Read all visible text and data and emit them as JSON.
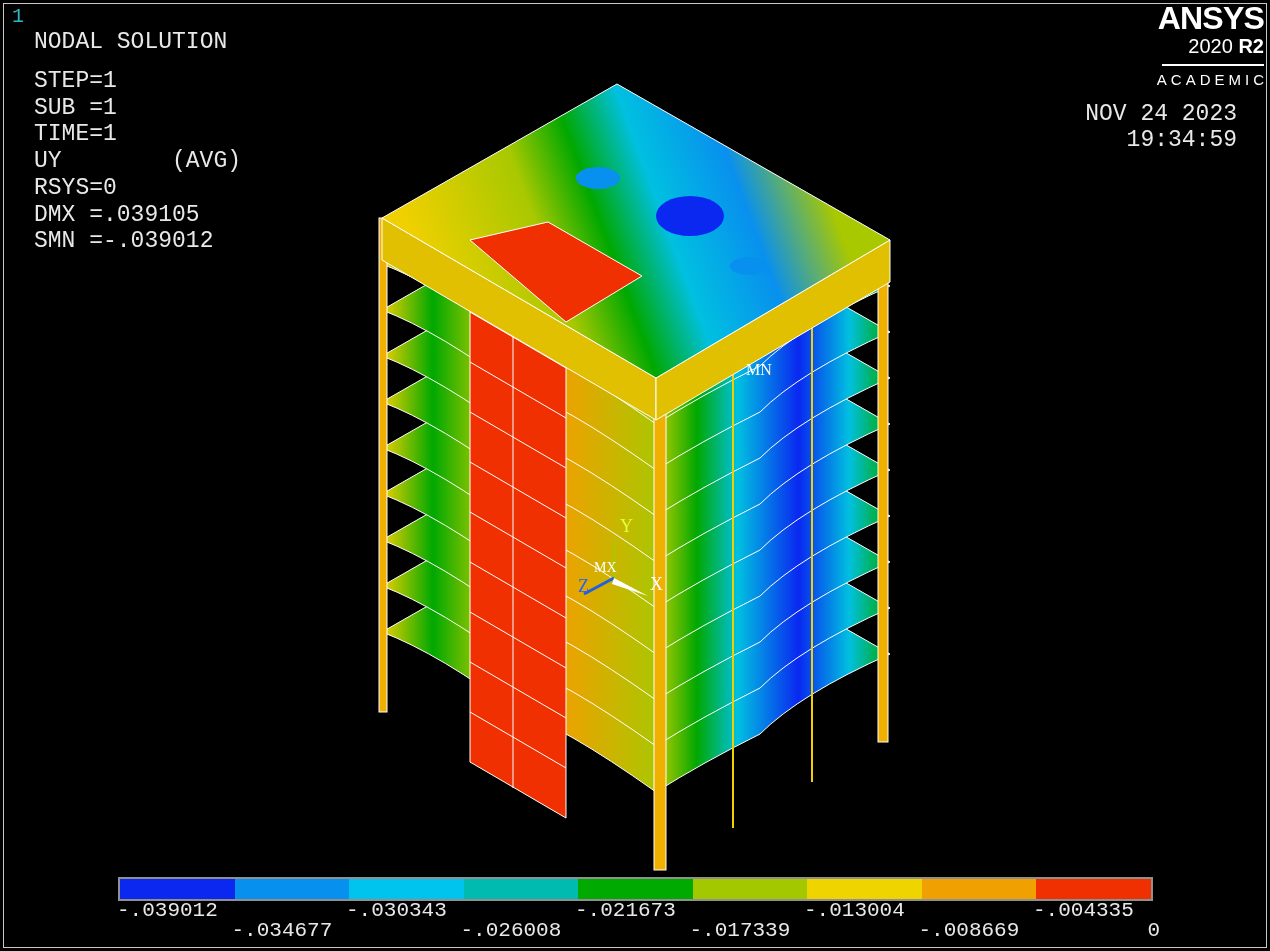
{
  "window_number": "1",
  "title": "NODAL SOLUTION",
  "info_lines": [
    [
      "STEP=1"
    ],
    [
      "SUB =1"
    ],
    [
      "TIME=1"
    ],
    [
      "UY",
      "(AVG)"
    ],
    [
      "RSYS=0"
    ],
    [
      "DMX =.039105"
    ],
    [
      "SMN =-.039012"
    ]
  ],
  "logo": {
    "name": "ANSYS",
    "version": "2020 **R2**",
    "edition": "ACADEMIC"
  },
  "date": "NOV 24 2023",
  "time": "19:34:59",
  "model_labels": {
    "min_marker": "MN",
    "max_marker": "MX",
    "axes": [
      {
        "label": "Y"
      },
      {
        "label": "Z"
      },
      {
        "label": "X"
      }
    ]
  },
  "legend": {
    "bands": [
      {
        "color": "#0a28f0"
      },
      {
        "color": "#0890ee"
      },
      {
        "color": "#00c4ee"
      },
      {
        "color": "#00bcb0"
      },
      {
        "color": "#00aa00"
      },
      {
        "color": "#a4c800"
      },
      {
        "color": "#f0d400"
      },
      {
        "color": "#f0a000"
      },
      {
        "color": "#f03000"
      }
    ],
    "labels": [
      "-.039012",
      "-.034677",
      "-.030343",
      "-.026008",
      "-.021673",
      "-.017339",
      "-.013004",
      "-.008669",
      "-.004335",
      "0"
    ]
  }
}
